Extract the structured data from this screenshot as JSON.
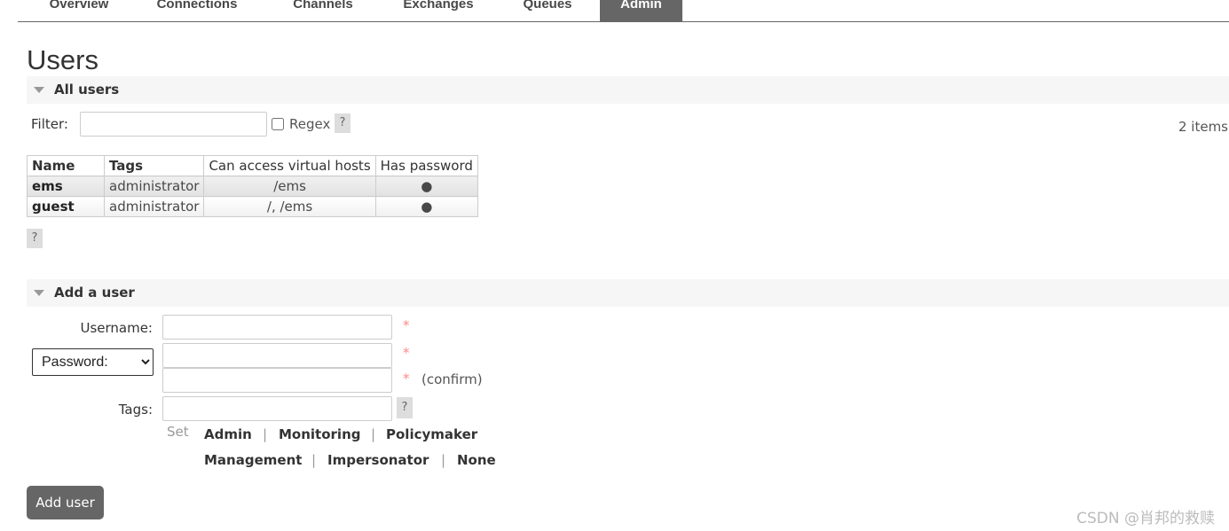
{
  "nav": {
    "tabs": [
      {
        "label": "Overview"
      },
      {
        "label": "Connections"
      },
      {
        "label": "Channels"
      },
      {
        "label": "Exchanges"
      },
      {
        "label": "Queues"
      },
      {
        "label": "Admin",
        "active": true
      }
    ]
  },
  "page_title": "Users",
  "all_users": {
    "title": "All users",
    "filter_label": "Filter:",
    "filter_value": "",
    "regex_label": "Regex",
    "help": "?",
    "count": "2 items",
    "columns": [
      "Name",
      "Tags",
      "Can access virtual hosts",
      "Has password"
    ],
    "rows": [
      {
        "name": "ems",
        "tags": "administrator",
        "vhosts": "/ems",
        "has_password": "●"
      },
      {
        "name": "guest",
        "tags": "administrator",
        "vhosts": "/, /ems",
        "has_password": "●"
      }
    ]
  },
  "add_user": {
    "title": "Add a user",
    "username_label": "Username:",
    "password_select": "Password:",
    "tags_label": "Tags:",
    "required": "*",
    "confirm": "(confirm)",
    "help": "?",
    "set_label": "Set",
    "tag_links": [
      "Admin",
      "Monitoring",
      "Policymaker",
      "Management",
      "Impersonator",
      "None"
    ],
    "separator": "|",
    "submit": "Add user"
  },
  "watermark": "CSDN @肖邦的救赎",
  "colors": {
    "active_tab": "#666666",
    "button": "#666666",
    "required": "#ff8888"
  }
}
